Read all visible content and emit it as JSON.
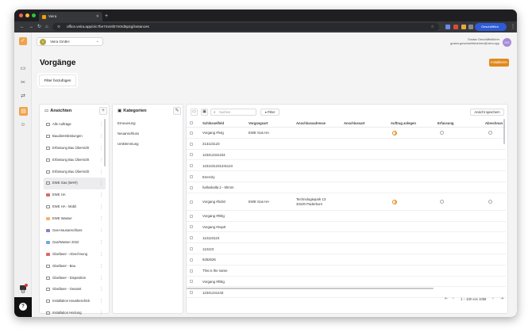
{
  "browser": {
    "tab_title": "Veira",
    "url": "office.veira.app/o/c7be7mmtl07n0rd6p2g/instances",
    "profile_label": "Geschäftlich"
  },
  "app": {
    "org_name": "Veira GmbH",
    "org_avatar_letter": "V",
    "user_name": "Gustav Geschäftsführer",
    "user_email": "gustav.geschaeftsfuehrer@veira.app",
    "user_initials": "GG",
    "page_title": "Vorgänge",
    "install_button": "Installieren",
    "filter_add_button": "Filter hinzufügen",
    "accent_color": "#e08a1e"
  },
  "views": {
    "header": "Ansichten",
    "add_label": "+",
    "items": [
      {
        "label": "Alle Aufträge"
      },
      {
        "label": "Baudienstleistungen"
      },
      {
        "label": "Erfassung Bau Übersicht"
      },
      {
        "label": "Erfassung Bau Übersicht"
      },
      {
        "label": "Erfassung Bau Übersicht"
      },
      {
        "label": "EWE Gas (MAR)"
      },
      {
        "label": "EWE HA"
      },
      {
        "label": "EWE HA - Mobil"
      },
      {
        "label": "EWE Wasser"
      },
      {
        "label": "Gas-Hausanschluss"
      },
      {
        "label": "Gas/Wasser 2022"
      },
      {
        "label": "Glasfaser - Abrechnung"
      },
      {
        "label": "Glasfaser - Bau"
      },
      {
        "label": "Glasfaser - Disposition"
      },
      {
        "label": "Glasfaser - Gesamt"
      },
      {
        "label": "Installation Hausbeschick"
      },
      {
        "label": "Installation Heizung"
      }
    ],
    "active_index": 5
  },
  "categories": {
    "header": "Kategorien",
    "items": [
      "Erneuerung",
      "Neuanschluss",
      "Umklemmung"
    ]
  },
  "table": {
    "search_placeholder": "Suchen",
    "filter_button": "Filter",
    "save_view_button": "Ansicht speichern",
    "columns": [
      "Schlüsselfeld",
      "Vorgangsart",
      "Anschlussadresse",
      "Anschlussart",
      "Auftrag anlegen",
      "Erfassung",
      "Abrechnun"
    ],
    "rows": [
      {
        "key": "Vorgang #h4g",
        "type": "EWE Gas HA",
        "address_line1": "",
        "address_line2": "",
        "auftrag": true,
        "erfassung": true,
        "abrechnung": true
      },
      {
        "key": "213123123",
        "type": "",
        "address_line1": "",
        "address_line2": "",
        "auftrag": false,
        "erfassung": false,
        "abrechnung": false
      },
      {
        "key": "123412341234",
        "type": "",
        "address_line1": "",
        "address_line2": "",
        "auftrag": false,
        "erfassung": false,
        "abrechnung": false
      },
      {
        "key": "1231231231231123",
        "type": "",
        "address_line1": "",
        "address_line2": "",
        "auftrag": false,
        "erfassung": false,
        "abrechnung": false
      },
      {
        "key": "Enercity",
        "type": "",
        "address_line1": "",
        "address_line2": "",
        "auftrag": false,
        "erfassung": false,
        "abrechnung": false
      },
      {
        "key": "halloskalla 2 - 5hmm",
        "type": "",
        "address_line1": "",
        "address_line2": "",
        "auftrag": false,
        "erfassung": false,
        "abrechnung": false
      },
      {
        "key": "Vorgang #bcb0",
        "type": "EWE Gas HA",
        "address_line1": "Technologiepark 13",
        "address_line2": "33100 Paderborn",
        "auftrag": true,
        "erfassung": true,
        "abrechnung": true
      },
      {
        "key": "Vorgang #l00g",
        "type": "",
        "address_line1": "",
        "address_line2": "",
        "auftrag": false,
        "erfassung": false,
        "abrechnung": false
      },
      {
        "key": "Vorgang #eup0",
        "type": "",
        "address_line1": "",
        "address_line2": "",
        "auftrag": false,
        "erfassung": false,
        "abrechnung": false
      },
      {
        "key": "113123123",
        "type": "",
        "address_line1": "",
        "address_line2": "",
        "auftrag": false,
        "erfassung": false,
        "abrechnung": false
      },
      {
        "key": "113123",
        "type": "",
        "address_line1": "",
        "address_line2": "",
        "auftrag": false,
        "erfassung": false,
        "abrechnung": false
      },
      {
        "key": "6262626",
        "type": "",
        "address_line1": "",
        "address_line2": "",
        "auftrag": false,
        "erfassung": false,
        "abrechnung": false
      },
      {
        "key": "This is the name",
        "type": "",
        "address_line1": "",
        "address_line2": "",
        "auftrag": false,
        "erfassung": false,
        "abrechnung": false
      },
      {
        "key": "Vorgang #l00g",
        "type": "",
        "address_line1": "",
        "address_line2": "",
        "auftrag": false,
        "erfassung": false,
        "abrechnung": false
      },
      {
        "key": "12341241243",
        "type": "",
        "address_line1": "",
        "address_line2": "",
        "auftrag": false,
        "erfassung": false,
        "abrechnung": false
      }
    ],
    "pagination": "1 – 100 von 1058"
  }
}
